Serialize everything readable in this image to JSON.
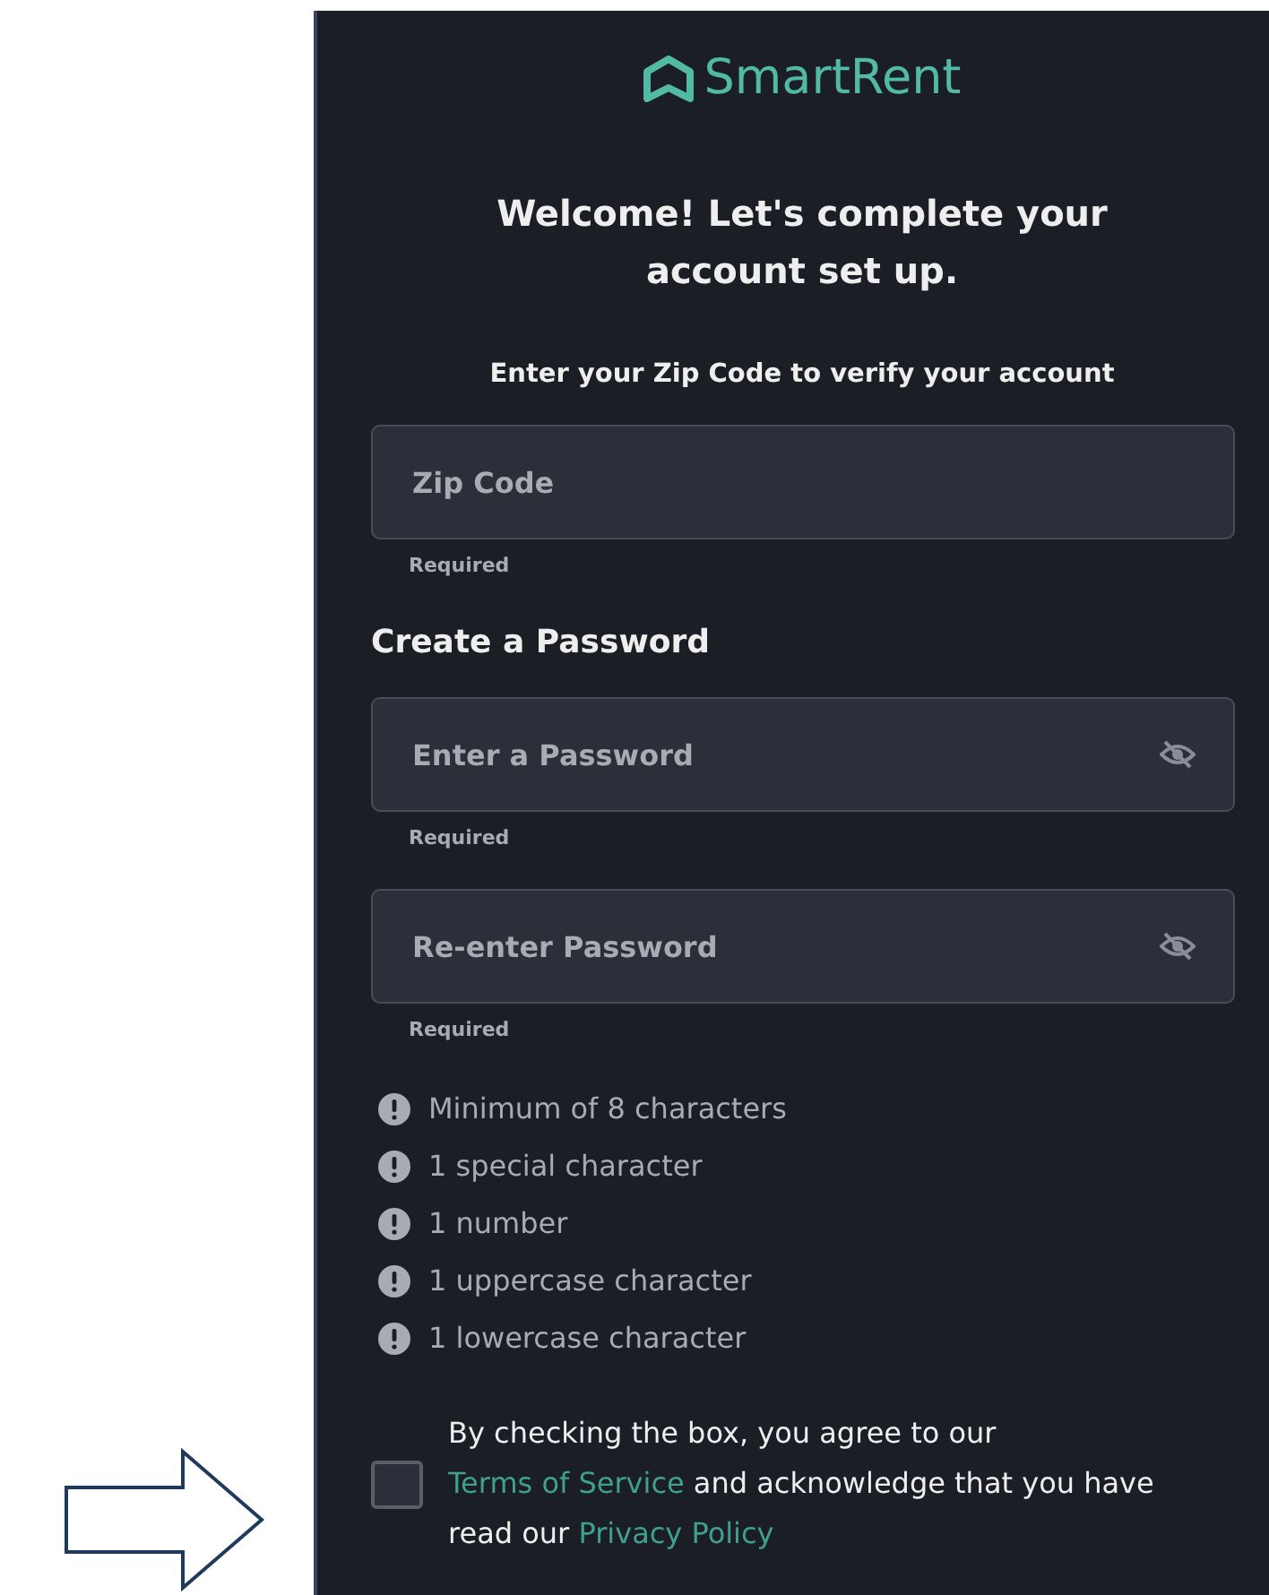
{
  "logo": {
    "text": "SmartRent"
  },
  "heading": "Welcome! Let's complete your account set up.",
  "subtitle": "Enter your Zip Code to verify your account",
  "zip": {
    "placeholder": "Zip Code",
    "hint": "Required"
  },
  "password_section": {
    "title": "Create a Password",
    "fields": [
      {
        "placeholder": "Enter a Password",
        "hint": "Required"
      },
      {
        "placeholder": "Re-enter Password",
        "hint": "Required"
      }
    ]
  },
  "requirements": [
    "Minimum of 8 characters",
    "1 special character",
    "1 number",
    "1 uppercase character",
    "1 lowercase character"
  ],
  "agreement": {
    "checked": false,
    "before": "By checking the box, you agree to our ",
    "terms_link": "Terms of Service",
    "middle": " and acknowledge that you have read our ",
    "privacy_link": "Privacy Policy"
  }
}
